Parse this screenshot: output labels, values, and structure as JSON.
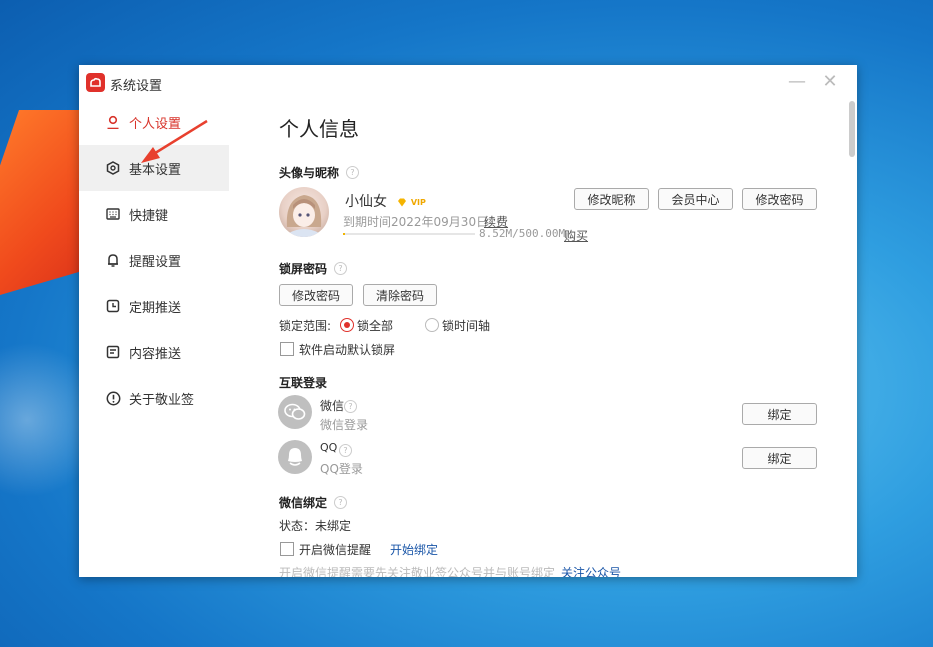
{
  "window": {
    "title": "系统设置",
    "minimize_symbol": "—",
    "close_symbol": "✕"
  },
  "sidebar": {
    "items": [
      {
        "label": "个人设置",
        "icon": "person-icon"
      },
      {
        "label": "基本设置",
        "icon": "hexagon-settings-icon"
      },
      {
        "label": "快捷键",
        "icon": "keyboard-icon"
      },
      {
        "label": "提醒设置",
        "icon": "bell-icon"
      },
      {
        "label": "定期推送",
        "icon": "clock-icon"
      },
      {
        "label": "内容推送",
        "icon": "document-icon"
      },
      {
        "label": "关于敬业签",
        "icon": "info-circle-icon"
      }
    ]
  },
  "main": {
    "page_title": "个人信息",
    "profile": {
      "section_title": "头像与昵称",
      "nickname": "小仙女",
      "vip_badge": "VIP",
      "expiry_text": "到期时间2022年09月30日",
      "renew_link": "续费",
      "storage_text": "8.52M/500.00M",
      "storage_used_fraction": 0.017,
      "buy_link": "购买",
      "buttons": {
        "edit_nickname": "修改昵称",
        "member_center": "会员中心",
        "change_password": "修改密码"
      }
    },
    "lock": {
      "section_title": "锁屏密码",
      "buttons": {
        "change_password": "修改密码",
        "clear_password": "清除密码"
      },
      "scope_label": "锁定范围:",
      "scope_options": [
        "锁全部",
        "锁时间轴"
      ],
      "scope_selected": "锁全部",
      "startup_lock_label": "软件启动默认锁屏",
      "startup_lock_checked": false
    },
    "linked_login": {
      "section_title": "互联登录",
      "accounts": [
        {
          "name": "微信",
          "sub": "微信登录",
          "button": "绑定",
          "icon": "wechat-icon"
        },
        {
          "name": "QQ",
          "sub": "QQ登录",
          "button": "绑定",
          "icon": "qq-icon"
        }
      ]
    },
    "wechat_bind": {
      "section_title": "微信绑定",
      "status": "状态：未绑定",
      "reminder_label": "开启微信提醒",
      "reminder_checked": false,
      "start_bind_link": "开始绑定",
      "hint_text": "开启微信提醒需要先关注敬业签公众号并与账号绑定",
      "follow_link": "关注公众号"
    }
  },
  "colors": {
    "accent": "#e0312b",
    "link": "#1a56a8",
    "arrow": "#e8402e"
  }
}
